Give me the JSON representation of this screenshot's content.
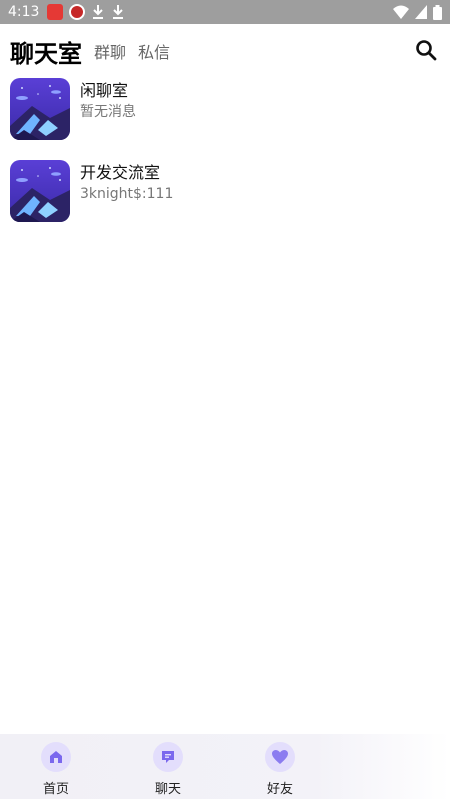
{
  "status_bar": {
    "time": "4:13",
    "left_icons": [
      "app-badge-red",
      "app-badge-round-red",
      "download-icon",
      "download-icon"
    ],
    "right_icons": [
      "wifi-icon",
      "signal-icon",
      "battery-icon"
    ]
  },
  "header": {
    "title": "聊天室",
    "tabs": [
      {
        "label": "群聊"
      },
      {
        "label": "私信"
      }
    ],
    "search_icon": "search-icon"
  },
  "chats": [
    {
      "name": "闲聊室",
      "last_message": "暂无消息"
    },
    {
      "name": "开发交流室",
      "last_message": "3knight$:111"
    }
  ],
  "bottom_nav": {
    "items": [
      {
        "label": "首页",
        "icon": "home-icon"
      },
      {
        "label": "聊天",
        "icon": "chat-icon"
      },
      {
        "label": "好友",
        "icon": "heart-icon"
      }
    ],
    "accent": "#7b68ee"
  }
}
